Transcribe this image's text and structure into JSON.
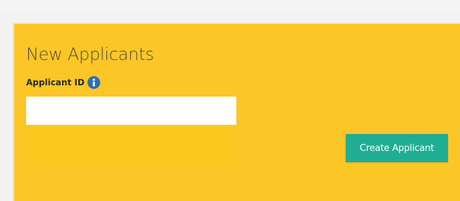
{
  "panel": {
    "title": "New Applicants",
    "background_color": "#fcc627"
  },
  "applicant_id": {
    "label": "Applicant ID",
    "icon": "info-icon",
    "value": "",
    "placeholder": ""
  },
  "actions": {
    "create_label": "Create Applicant",
    "create_color": "#1fae93"
  }
}
